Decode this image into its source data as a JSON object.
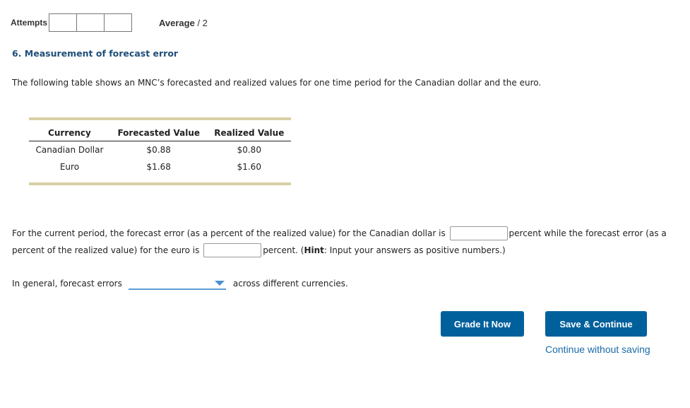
{
  "header": {
    "attempts_label": "Attempts",
    "attempt_boxes": 3,
    "average_label": "Average",
    "average_suffix": "/ 2"
  },
  "question": {
    "title": "6. Measurement of forecast error",
    "intro": "The following table shows an MNC’s forecasted and realized values for one time period for the Canadian dollar and the euro."
  },
  "table": {
    "headers": [
      "Currency",
      "Forecasted Value",
      "Realized Value"
    ],
    "rows": [
      [
        "Canadian Dollar",
        "$0.88",
        "$0.80"
      ],
      [
        "Euro",
        "$1.68",
        "$1.60"
      ]
    ]
  },
  "paragraph": {
    "part1": "For the current period, the forecast error (as a percent of the realized value) for the Canadian dollar is",
    "cad_input_value": "",
    "part2": "percent while the forecast error (as a percent of the realized value) for the euro is",
    "euro_input_value": "",
    "part3": "percent. (",
    "hint_label": "Hint",
    "hint_text": ": Input your answers as positive numbers.)"
  },
  "general": {
    "prefix": "In general, forecast errors",
    "dropdown_selected": "",
    "suffix": "across different currencies."
  },
  "buttons": {
    "grade": "Grade It Now",
    "save": "Save & Continue",
    "continue_link": "Continue without saving"
  },
  "colors": {
    "button_bg": "#00609c",
    "title": "#1f4e79",
    "table_rule": "#d9cfa5",
    "link": "#1a6aa6"
  }
}
